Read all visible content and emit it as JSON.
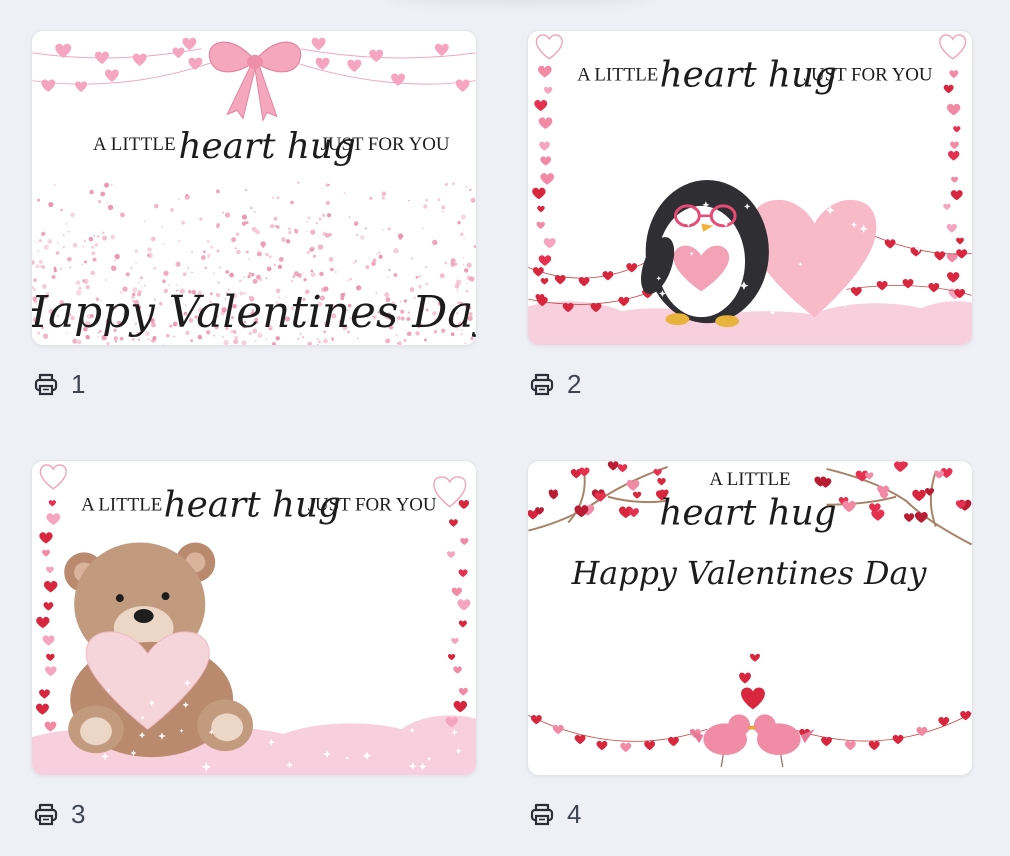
{
  "colors": {
    "background": "#eef0f5",
    "card_background": "#ffffff",
    "text": "#3f4451",
    "heart_red": "#d7263d",
    "heart_pink": "#f08cab",
    "soft_pink": "#f7c6d6"
  },
  "cards": [
    {
      "lines": {
        "pre": "A LITTLE",
        "script": "heart hug",
        "post": "JUST FOR YOU",
        "greeting": "Happy Valentines Day"
      },
      "caption": {
        "icon": "printer-icon",
        "count": "1"
      }
    },
    {
      "lines": {
        "pre": "A LITTLE",
        "script": "heart hug",
        "post": "JUST FOR YOU"
      },
      "caption": {
        "icon": "printer-icon",
        "count": "2"
      }
    },
    {
      "lines": {
        "pre": "A LITTLE",
        "script": "heart hug",
        "post": "JUST FOR YOU"
      },
      "caption": {
        "icon": "printer-icon",
        "count": "3"
      }
    },
    {
      "lines": {
        "pre": "A LITTLE",
        "script": "heart hug",
        "greeting": "Happy Valentines Day"
      },
      "caption": {
        "icon": "printer-icon",
        "count": "4"
      }
    }
  ]
}
